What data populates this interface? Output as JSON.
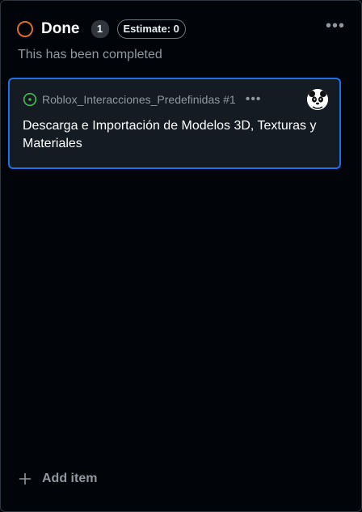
{
  "column": {
    "title": "Done",
    "count": "1",
    "estimate": "Estimate: 0",
    "description": "This has been completed",
    "status_color": "#db6d28",
    "more_icon": "ellipsis-icon"
  },
  "card": {
    "repo_ref": "Roblox_Interacciones_Predefinidas #1",
    "title": "Descarga e Importación de Modelos 3D, Texturas y Materiales",
    "status_icon": "issue-open-icon",
    "status_color": "#3fb950",
    "border_color": "#1f6feb"
  },
  "footer": {
    "add_label": "Add item"
  }
}
